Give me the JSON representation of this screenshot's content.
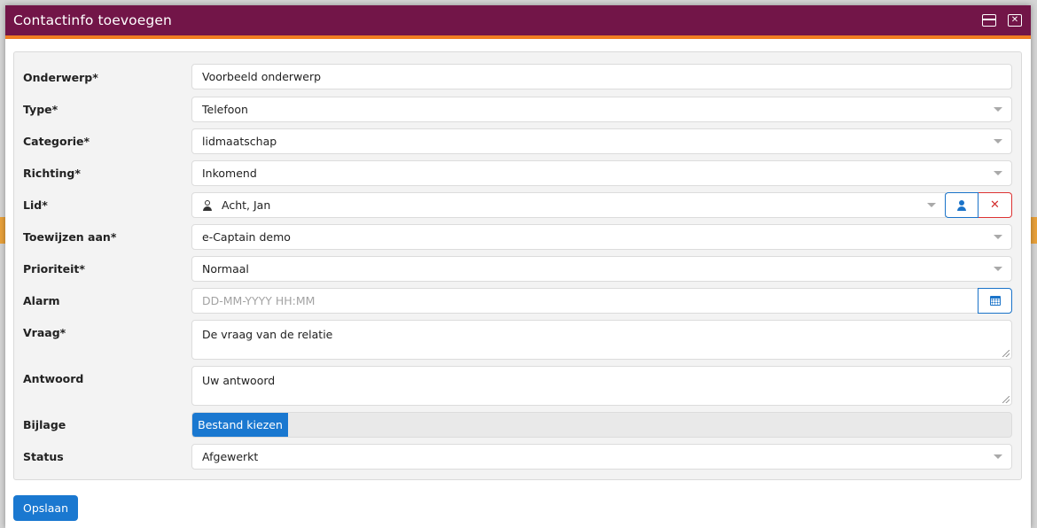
{
  "dialog": {
    "title": "Contactinfo toevoegen",
    "maximize_icon": "maximize-icon",
    "close_icon": "close-icon"
  },
  "colors": {
    "header_bg": "#721548",
    "header_accent": "#f07d22",
    "primary": "#1a78d0",
    "danger": "#d32f2f"
  },
  "form": {
    "onderwerp": {
      "label": "Onderwerp*",
      "value": "Voorbeeld onderwerp"
    },
    "type": {
      "label": "Type*",
      "value": "Telefoon"
    },
    "categorie": {
      "label": "Categorie*",
      "value": "lidmaatschap"
    },
    "richting": {
      "label": "Richting*",
      "value": "Inkomend"
    },
    "lid": {
      "label": "Lid*",
      "value": "Acht, Jan",
      "select_icon": "person-icon",
      "clear_icon": "x-icon"
    },
    "toewijzen": {
      "label": "Toewijzen aan*",
      "value": "e-Captain demo"
    },
    "prioriteit": {
      "label": "Prioriteit*",
      "value": "Normaal"
    },
    "alarm": {
      "label": "Alarm",
      "placeholder": "DD-MM-YYYY HH:MM",
      "button_icon": "calendar-icon"
    },
    "vraag": {
      "label": "Vraag*",
      "placeholder": "De vraag van de relatie"
    },
    "antwoord": {
      "label": "Antwoord",
      "placeholder": "Uw antwoord"
    },
    "bijlage": {
      "label": "Bijlage",
      "button_label": "Bestand kiezen"
    },
    "status": {
      "label": "Status",
      "value": "Afgewerkt"
    }
  },
  "footer": {
    "save_label": "Opslaan"
  }
}
